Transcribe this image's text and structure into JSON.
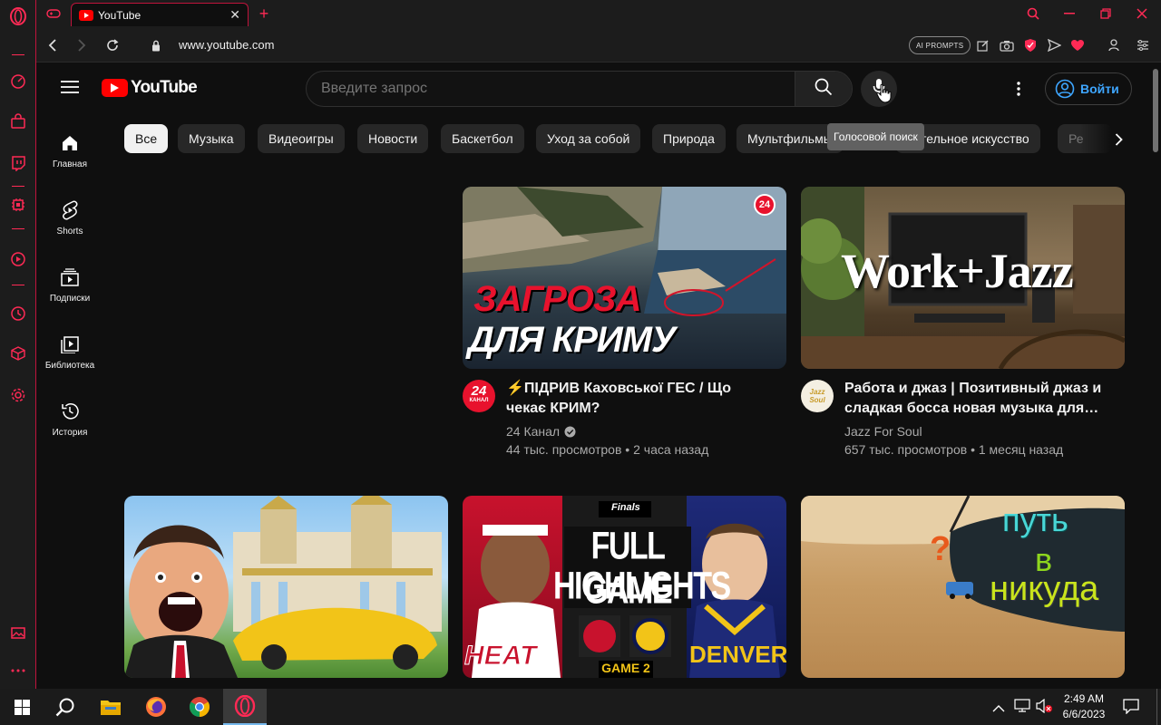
{
  "browser": {
    "tab_title": "YouTube",
    "url": "www.youtube.com",
    "ai_prompts_label": "AI PROMPTS"
  },
  "youtube": {
    "logo_text": "YouTube",
    "search_placeholder": "Введите запрос",
    "tooltip": "Голосовой поиск",
    "signin_label": "Войти",
    "nav": [
      {
        "label": "Главная",
        "icon": "home-icon"
      },
      {
        "label": "Shorts",
        "icon": "shorts-icon"
      },
      {
        "label": "Подписки",
        "icon": "subscriptions-icon"
      },
      {
        "label": "Библиотека",
        "icon": "library-icon"
      },
      {
        "label": "История",
        "icon": "history-icon"
      }
    ],
    "chips": [
      "Все",
      "Музыка",
      "Видеоигры",
      "Новости",
      "Баскетбол",
      "Уход за собой",
      "Природа",
      "Мультфильмы",
      "Изобразительное искусство",
      "Ре"
    ],
    "chip_partial_visible": "тельное искусство",
    "videos": [
      {
        "thumb_text_1": "ЗАГРОЗА",
        "thumb_text_2": "ДЛЯ КРИМУ",
        "thumb_badge": "24",
        "title_line1": "⚡ПІДРИВ Каховської ГЕС / Що",
        "title_line2": "чекає КРИМ?",
        "channel": "24 Канал",
        "verified": true,
        "avatar_text": "24",
        "avatar_sub": "КАНАЛ",
        "views": "44 тыс. просмотров",
        "age": "2 часа назад"
      },
      {
        "thumb_text_1": "Work+Jazz",
        "title_line1": "Работа и джаз | Позитивный джаз и",
        "title_line2": "сладкая босса новая музыка для…",
        "channel": "Jazz For Soul",
        "avatar_text": "Jazz Soul",
        "views": "657 тыс. просмотров",
        "age": "1 месяц назад"
      }
    ],
    "row2": [
      {
        "thumb_text": ""
      },
      {
        "thumb_text_1": "FULL GAME",
        "thumb_text_2": "HIGHLIGHTS",
        "badge_game": "GAME 2",
        "team_left": "HEAT",
        "team_right": "DENVER",
        "finals_label": "Finals"
      },
      {
        "thumb_text_1": "путь",
        "thumb_text_2": "в",
        "thumb_text_3": "никуда",
        "question": "?"
      }
    ]
  },
  "taskbar": {
    "time": "2:49 AM",
    "date": "6/6/2023"
  },
  "colors": {
    "opera_red": "#ff2a55",
    "yt_red": "#ff0000",
    "bg": "#0f0f0f",
    "chip": "#272727",
    "signin_blue": "#3ea6ff"
  }
}
